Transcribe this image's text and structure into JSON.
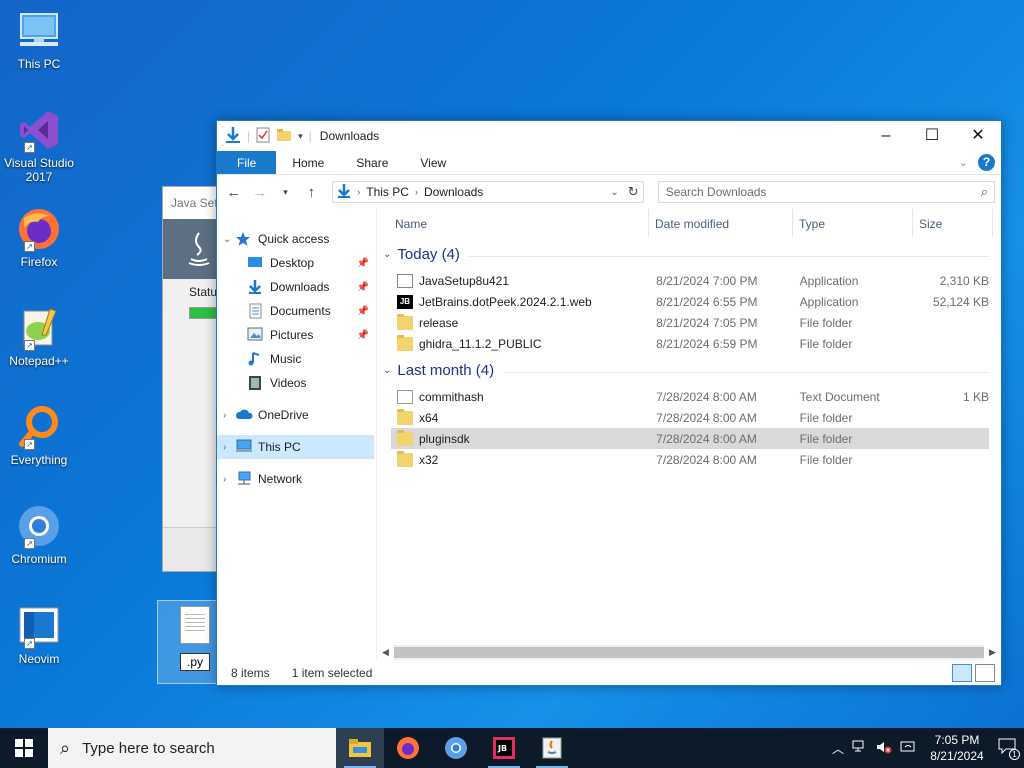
{
  "desktop": {
    "icons": [
      {
        "label": "This PC",
        "icon": "computer-icon"
      },
      {
        "label": "Visual Studio 2017",
        "icon": "visual-studio-icon"
      },
      {
        "label": "Firefox",
        "icon": "firefox-icon"
      },
      {
        "label": "Notepad++",
        "icon": "notepad-plus-plus-icon"
      },
      {
        "label": "Everything",
        "icon": "everything-search-icon"
      },
      {
        "label": "Chromium",
        "icon": "chromium-icon"
      },
      {
        "label": "Neovim",
        "icon": "neovim-icon"
      }
    ],
    "java_window": {
      "title": "Java Setu",
      "status_label": "Statu"
    },
    "selected_file": {
      "rename_value": ".py"
    }
  },
  "explorer": {
    "title": "Downloads",
    "tabs": {
      "file": "File",
      "home": "Home",
      "share": "Share",
      "view": "View"
    },
    "breadcrumb": [
      "This PC",
      "Downloads"
    ],
    "search_placeholder": "Search Downloads",
    "columns": {
      "name": "Name",
      "date": "Date modified",
      "type": "Type",
      "size": "Size"
    },
    "nav": {
      "quick_access": "Quick access",
      "desktop": "Desktop",
      "downloads": "Downloads",
      "documents": "Documents",
      "pictures": "Pictures",
      "music": "Music",
      "videos": "Videos",
      "onedrive": "OneDrive",
      "this_pc": "This PC",
      "network": "Network"
    },
    "groups": [
      {
        "label": "Today (4)",
        "files": [
          {
            "name": "JavaSetup8u421",
            "date": "8/21/2024 7:00 PM",
            "type": "Application",
            "size": "2,310 KB",
            "icon": "java-installer-icon"
          },
          {
            "name": "JetBrains.dotPeek.2024.2.1.web",
            "date": "8/21/2024 6:55 PM",
            "type": "Application",
            "size": "52,124 KB",
            "icon": "jetbrains-icon"
          },
          {
            "name": "release",
            "date": "8/21/2024 7:05 PM",
            "type": "File folder",
            "size": "",
            "icon": "folder-icon"
          },
          {
            "name": "ghidra_11.1.2_PUBLIC",
            "date": "8/21/2024 6:59 PM",
            "type": "File folder",
            "size": "",
            "icon": "folder-icon"
          }
        ]
      },
      {
        "label": "Last month (4)",
        "files": [
          {
            "name": "commithash",
            "date": "7/28/2024 8:00 AM",
            "type": "Text Document",
            "size": "1 KB",
            "icon": "text-file-icon"
          },
          {
            "name": "x64",
            "date": "7/28/2024 8:00 AM",
            "type": "File folder",
            "size": "",
            "icon": "folder-icon"
          },
          {
            "name": "pluginsdk",
            "date": "7/28/2024 8:00 AM",
            "type": "File folder",
            "size": "",
            "icon": "folder-icon",
            "selected": true
          },
          {
            "name": "x32",
            "date": "7/28/2024 8:00 AM",
            "type": "File folder",
            "size": "",
            "icon": "folder-icon"
          }
        ]
      }
    ],
    "status": {
      "count": "8 items",
      "selection": "1 item selected"
    }
  },
  "taskbar": {
    "search_placeholder": "Type here to search",
    "apps": [
      "file-explorer-icon",
      "firefox-icon",
      "chromium-icon",
      "jetbrains-icon",
      "java-setup-icon"
    ],
    "time": "7:05 PM",
    "date": "8/21/2024",
    "notification_count": "1"
  },
  "colors": {
    "accent": "#1979ca",
    "selection": "#cce8ff",
    "desktop": "#0a78d7",
    "taskbar": "#0c1a29"
  }
}
